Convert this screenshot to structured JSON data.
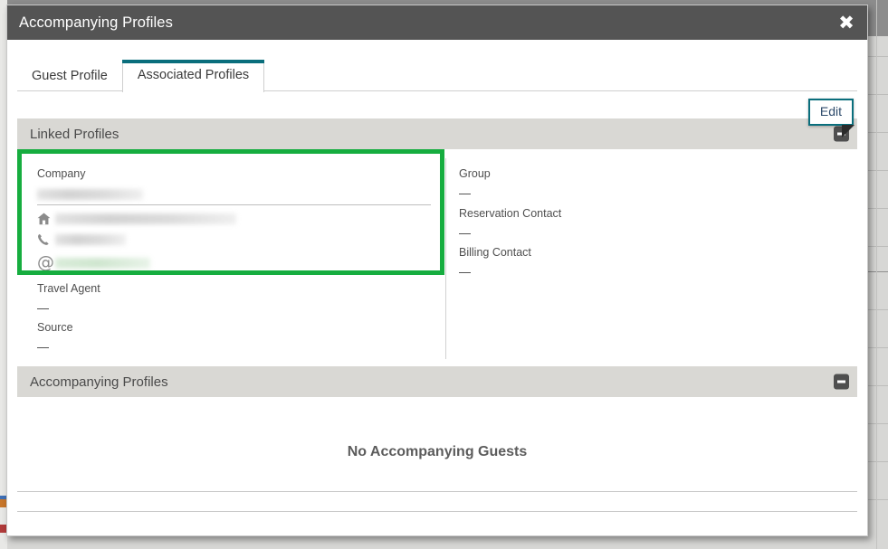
{
  "modal": {
    "title": "Accompanying Profiles",
    "close_label": "✖"
  },
  "tabs": [
    {
      "label": "Guest Profile",
      "active": false
    },
    {
      "label": "Associated Profiles",
      "active": true
    }
  ],
  "edit_button": {
    "label": "Edit"
  },
  "sections": [
    {
      "title": "Linked Profiles",
      "collapse_label": "−"
    },
    {
      "title": "Accompanying Profiles",
      "collapse_label": "−",
      "empty_message": "No Accompanying Guests"
    }
  ],
  "linked_profiles": {
    "left_column": {
      "company": {
        "label": "Company",
        "value": "",
        "redacted": true,
        "contacts": [
          {
            "icon": "home-icon",
            "value": "",
            "redacted": true
          },
          {
            "icon": "phone-icon",
            "value": "",
            "redacted": true
          },
          {
            "icon": "email-at-icon",
            "value": "",
            "redacted": true
          }
        ]
      },
      "fields": [
        {
          "label": "Travel Agent",
          "value": "—"
        },
        {
          "label": "Source",
          "value": "—"
        }
      ]
    },
    "right_column": {
      "fields": [
        {
          "label": "Group",
          "value": "—"
        },
        {
          "label": "Reservation Contact",
          "value": "—"
        },
        {
          "label": "Billing Contact",
          "value": "—"
        }
      ]
    }
  },
  "colors": {
    "header_bar": "#545454",
    "tab_accent": "#0a6e7c",
    "section_bar": "#d9d8d4",
    "highlight_green": "#16ad3f",
    "edit_border": "#0a6e7c"
  }
}
